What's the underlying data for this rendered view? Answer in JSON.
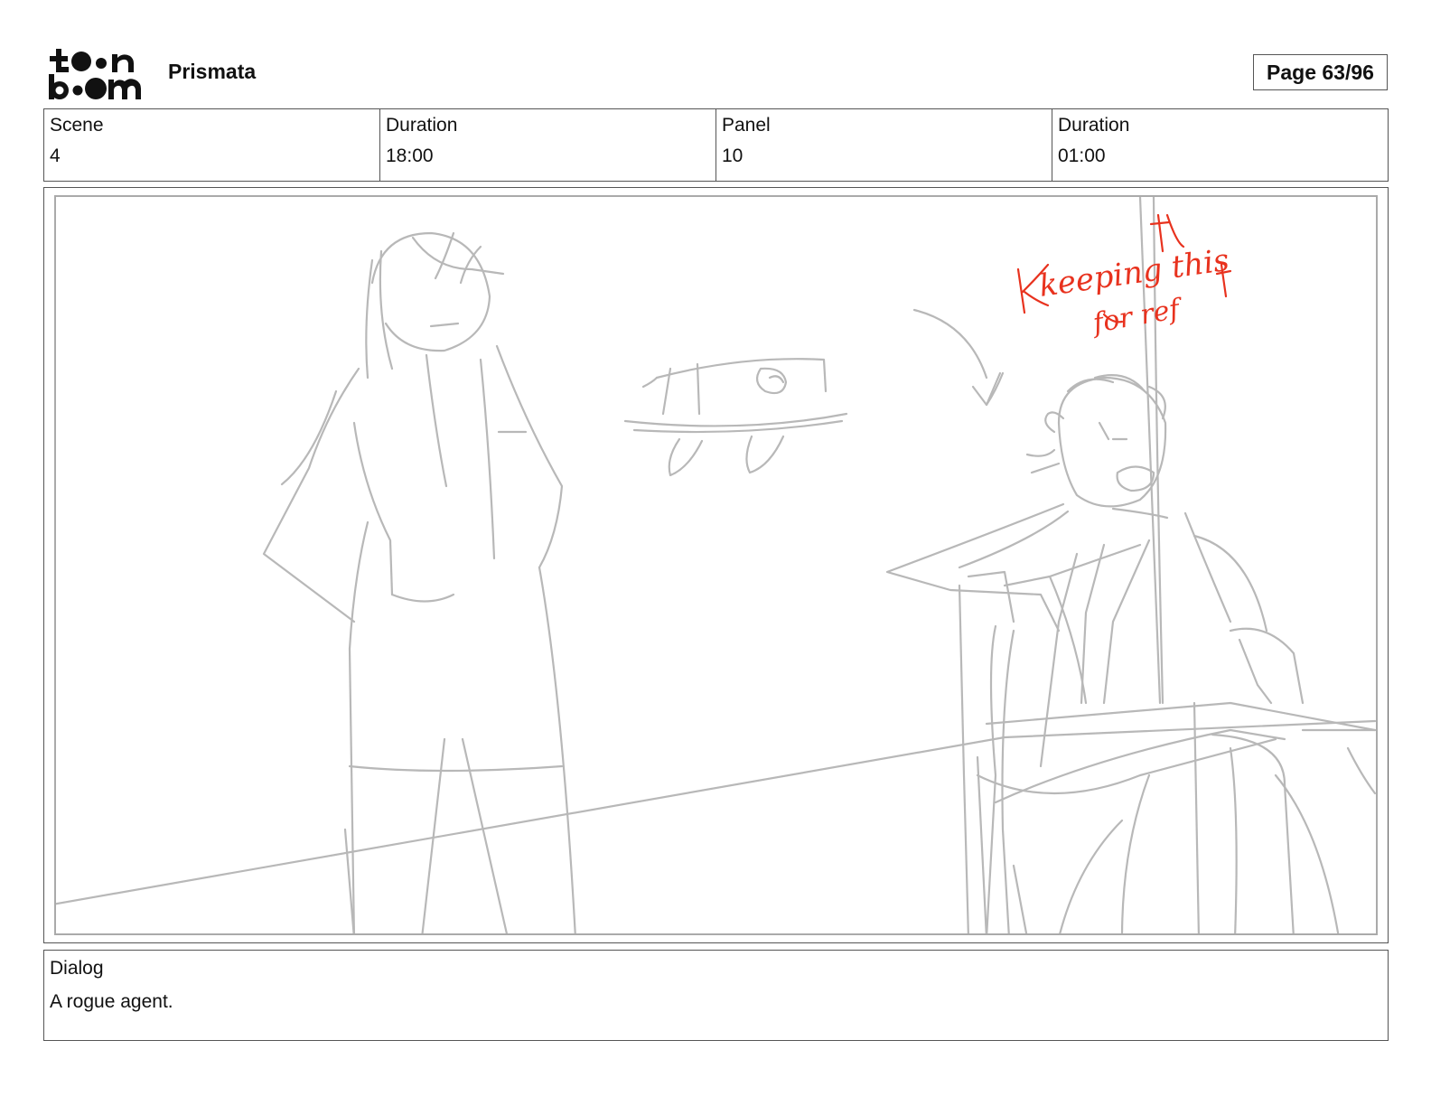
{
  "header": {
    "logo_text": "toon boom",
    "project": "Prismata",
    "page": "Page 63/96"
  },
  "info": {
    "scene_label": "Scene",
    "scene_value": "4",
    "scene_duration_label": "Duration",
    "scene_duration_value": "18:00",
    "panel_label": "Panel",
    "panel_value": "10",
    "panel_duration_label": "Duration",
    "panel_duration_value": "01:00"
  },
  "panel": {
    "annotation_lines": [
      "keeping this",
      "for ref"
    ],
    "sketch_color": "#b8b8b8",
    "annotation_color": "#e8321e"
  },
  "dialog": {
    "label": "Dialog",
    "text": "A rogue agent."
  }
}
